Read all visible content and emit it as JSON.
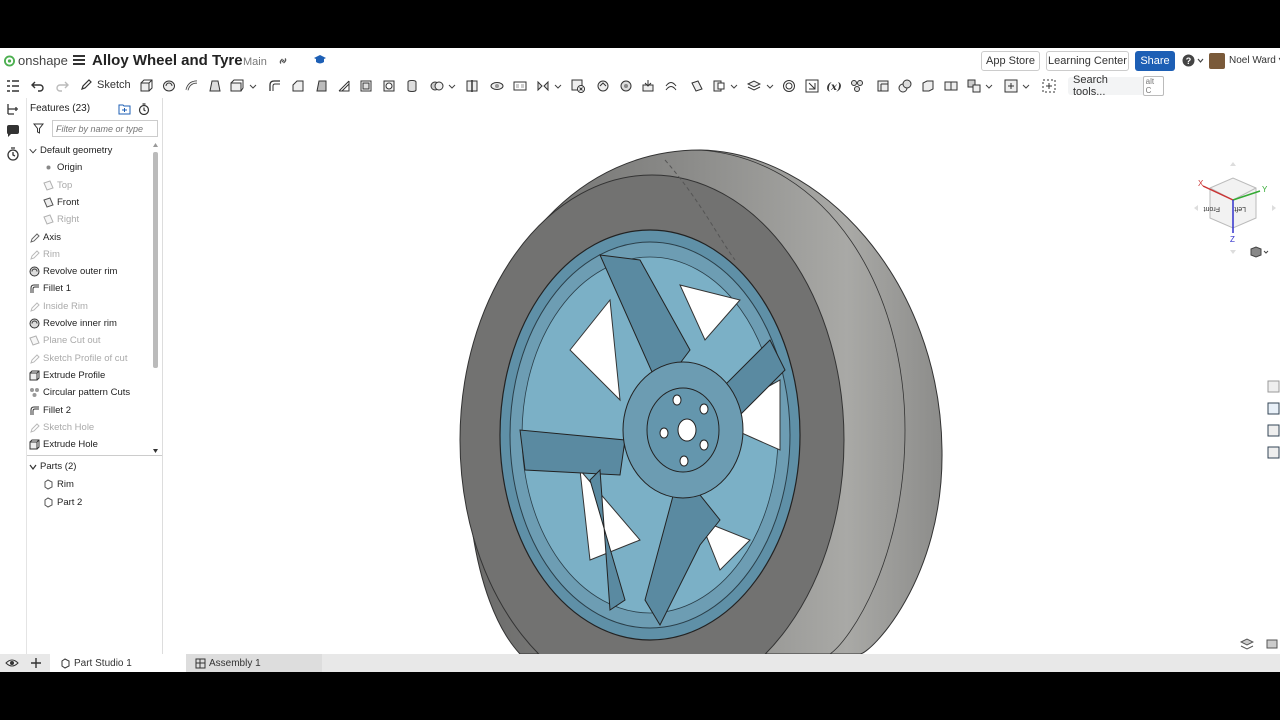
{
  "app": {
    "name": "onshape"
  },
  "document": {
    "title": "Alloy Wheel and Tyre",
    "branch": "Main"
  },
  "header": {
    "app_store": "App Store",
    "learning_center": "Learning Center",
    "share": "Share",
    "user": "Noel Ward"
  },
  "toolbar": {
    "sketch": "Sketch",
    "search_tools": "Search tools...",
    "search_shortcut": "alt C"
  },
  "features": {
    "title": "Features (23)",
    "filter_placeholder": "Filter by name or type",
    "items": [
      {
        "label": "Default geometry",
        "icon": "caret-down-icon",
        "dim": false
      },
      {
        "label": "Origin",
        "icon": "origin-icon",
        "dim": false
      },
      {
        "label": "Top",
        "icon": "plane-icon",
        "dim": true
      },
      {
        "label": "Front",
        "icon": "plane-icon",
        "dim": false
      },
      {
        "label": "Right",
        "icon": "plane-icon",
        "dim": true
      },
      {
        "label": "Axis",
        "icon": "sketch-icon",
        "dim": false
      },
      {
        "label": "Rim",
        "icon": "sketch-icon",
        "dim": true
      },
      {
        "label": "Revolve outer rim",
        "icon": "revolve-icon",
        "dim": false
      },
      {
        "label": "Fillet 1",
        "icon": "fillet-icon",
        "dim": false
      },
      {
        "label": "Inside Rim",
        "icon": "sketch-icon",
        "dim": true
      },
      {
        "label": "Revolve inner rim",
        "icon": "revolve-icon",
        "dim": false
      },
      {
        "label": "Plane Cut out",
        "icon": "plane-icon",
        "dim": true
      },
      {
        "label": "Sketch Profile of cut",
        "icon": "sketch-icon",
        "dim": true
      },
      {
        "label": "Extrude Profile",
        "icon": "extrude-icon",
        "dim": false
      },
      {
        "label": "Circular pattern Cuts",
        "icon": "pattern-icon",
        "dim": false
      },
      {
        "label": "Fillet 2",
        "icon": "fillet-icon",
        "dim": false
      },
      {
        "label": "Sketch Hole",
        "icon": "sketch-icon",
        "dim": true
      },
      {
        "label": "Extrude Hole",
        "icon": "extrude-icon",
        "dim": false
      }
    ]
  },
  "parts": {
    "title": "Parts (2)",
    "items": [
      {
        "label": "Rim"
      },
      {
        "label": "Part 2"
      }
    ]
  },
  "viewcube": {
    "front": "Front",
    "left": "Left",
    "x": "X",
    "y": "Y",
    "z": "Z"
  },
  "tabs": [
    {
      "label": "Part Studio 1",
      "active": true
    },
    {
      "label": "Assembly 1",
      "active": false
    }
  ],
  "colors": {
    "accent": "#1d5fb5",
    "logo": "#4caf50",
    "rim": "#6b9fb6",
    "tyre": "#7a7a78"
  }
}
